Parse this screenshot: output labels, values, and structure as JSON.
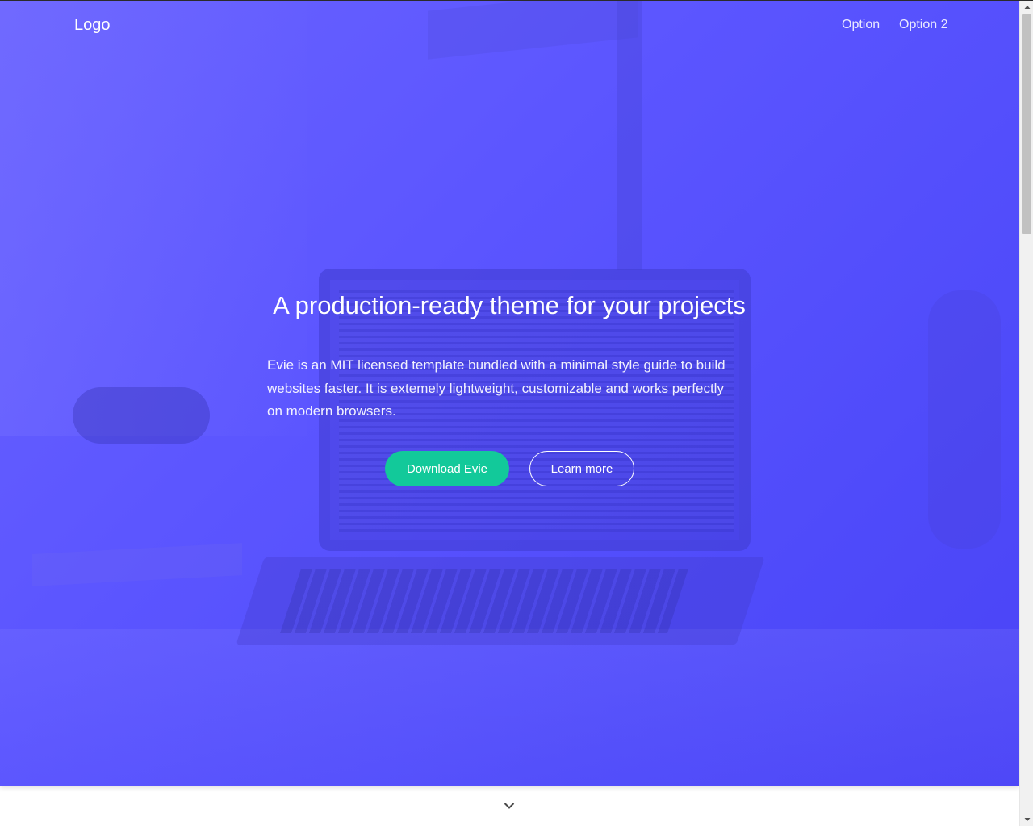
{
  "nav": {
    "logo": "Logo",
    "links": [
      "Option",
      "Option 2"
    ]
  },
  "hero": {
    "headline": "A production-ready theme for your projects",
    "description": "Evie is an MIT licensed template bundled with a minimal style guide to build websites faster. It is extemely lightweight, customizable and works perfectly on modern browsers.",
    "primary_button": "Download Evie",
    "secondary_button": "Learn more"
  },
  "icons": {
    "scroll_down": "chevron-down-icon",
    "scrollbar_up": "scroll-up-arrow-icon",
    "scrollbar_down": "scroll-down-arrow-icon"
  },
  "colors": {
    "hero_gradient_start": "#6a63ff",
    "hero_gradient_end": "#4a43f6",
    "primary_button": "#12c99a",
    "text": "#ffffff"
  }
}
